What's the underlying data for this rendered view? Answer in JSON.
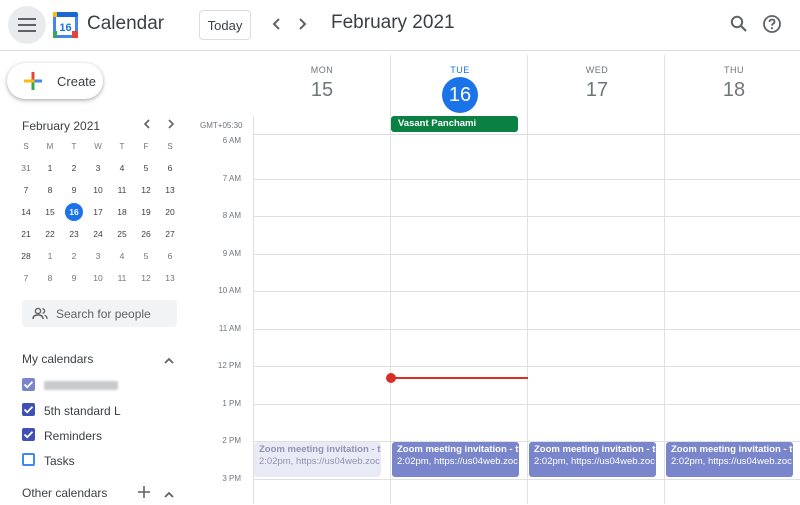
{
  "app": {
    "title": "Calendar",
    "logo_text": "16"
  },
  "toolbar": {
    "today_label": "Today",
    "period_title": "February 2021"
  },
  "sidebar": {
    "create_label": "Create",
    "mini_calendar": {
      "title": "February 2021",
      "weekday_headers": [
        "S",
        "M",
        "T",
        "W",
        "T",
        "F",
        "S"
      ],
      "weeks": [
        [
          "31",
          "1",
          "2",
          "3",
          "4",
          "5",
          "6"
        ],
        [
          "7",
          "8",
          "9",
          "10",
          "11",
          "12",
          "13"
        ],
        [
          "14",
          "15",
          "16",
          "17",
          "18",
          "19",
          "20"
        ],
        [
          "21",
          "22",
          "23",
          "24",
          "25",
          "26",
          "27"
        ],
        [
          "28",
          "1",
          "2",
          "3",
          "4",
          "5",
          "6"
        ],
        [
          "7",
          "8",
          "9",
          "10",
          "11",
          "12",
          "13"
        ]
      ],
      "selected": "16"
    },
    "search_people_placeholder": "Search for people",
    "my_calendars_title": "My calendars",
    "calendars": [
      {
        "label": "",
        "color": "#7986cb",
        "checked": true
      },
      {
        "label": "5th standard L",
        "color": "#3f51b5",
        "checked": true
      },
      {
        "label": "Reminders",
        "color": "#3f51b5",
        "checked": true
      },
      {
        "label": "Tasks",
        "color": "#4285f4",
        "checked": false
      }
    ],
    "other_calendars_title": "Other calendars"
  },
  "week": {
    "timezone": "GMT+05:30",
    "days": [
      {
        "name": "MON",
        "number": "15",
        "today": false
      },
      {
        "name": "TUE",
        "number": "16",
        "today": true
      },
      {
        "name": "WED",
        "number": "17",
        "today": false
      },
      {
        "name": "THU",
        "number": "18",
        "today": false
      }
    ],
    "all_day_event": "Vasant Panchami",
    "hours": [
      "6 AM",
      "7 AM",
      "8 AM",
      "9 AM",
      "10 AM",
      "11 AM",
      "12 PM",
      "1 PM",
      "2 PM",
      "3 PM"
    ],
    "events": [
      {
        "title": "Zoom meeting invitation - tu",
        "detail": "2:02pm, https://us04web.zoc",
        "day": 0,
        "past": true
      },
      {
        "title": "Zoom meeting invitation - tu",
        "detail": "2:02pm, https://us04web.zoc",
        "day": 1,
        "past": false
      },
      {
        "title": "Zoom meeting invitation - tu",
        "detail": "2:02pm, https://us04web.zoc",
        "day": 2,
        "past": false
      },
      {
        "title": "Zoom meeting invitation - tu",
        "detail": "2:02pm, https://us04web.zoc",
        "day": 3,
        "past": false
      }
    ]
  },
  "colors": {
    "accent": "#1a73e8",
    "event": "#7986cb",
    "event_past": "#e8eaf6",
    "holiday": "#0b8043",
    "now": "#d93025"
  }
}
